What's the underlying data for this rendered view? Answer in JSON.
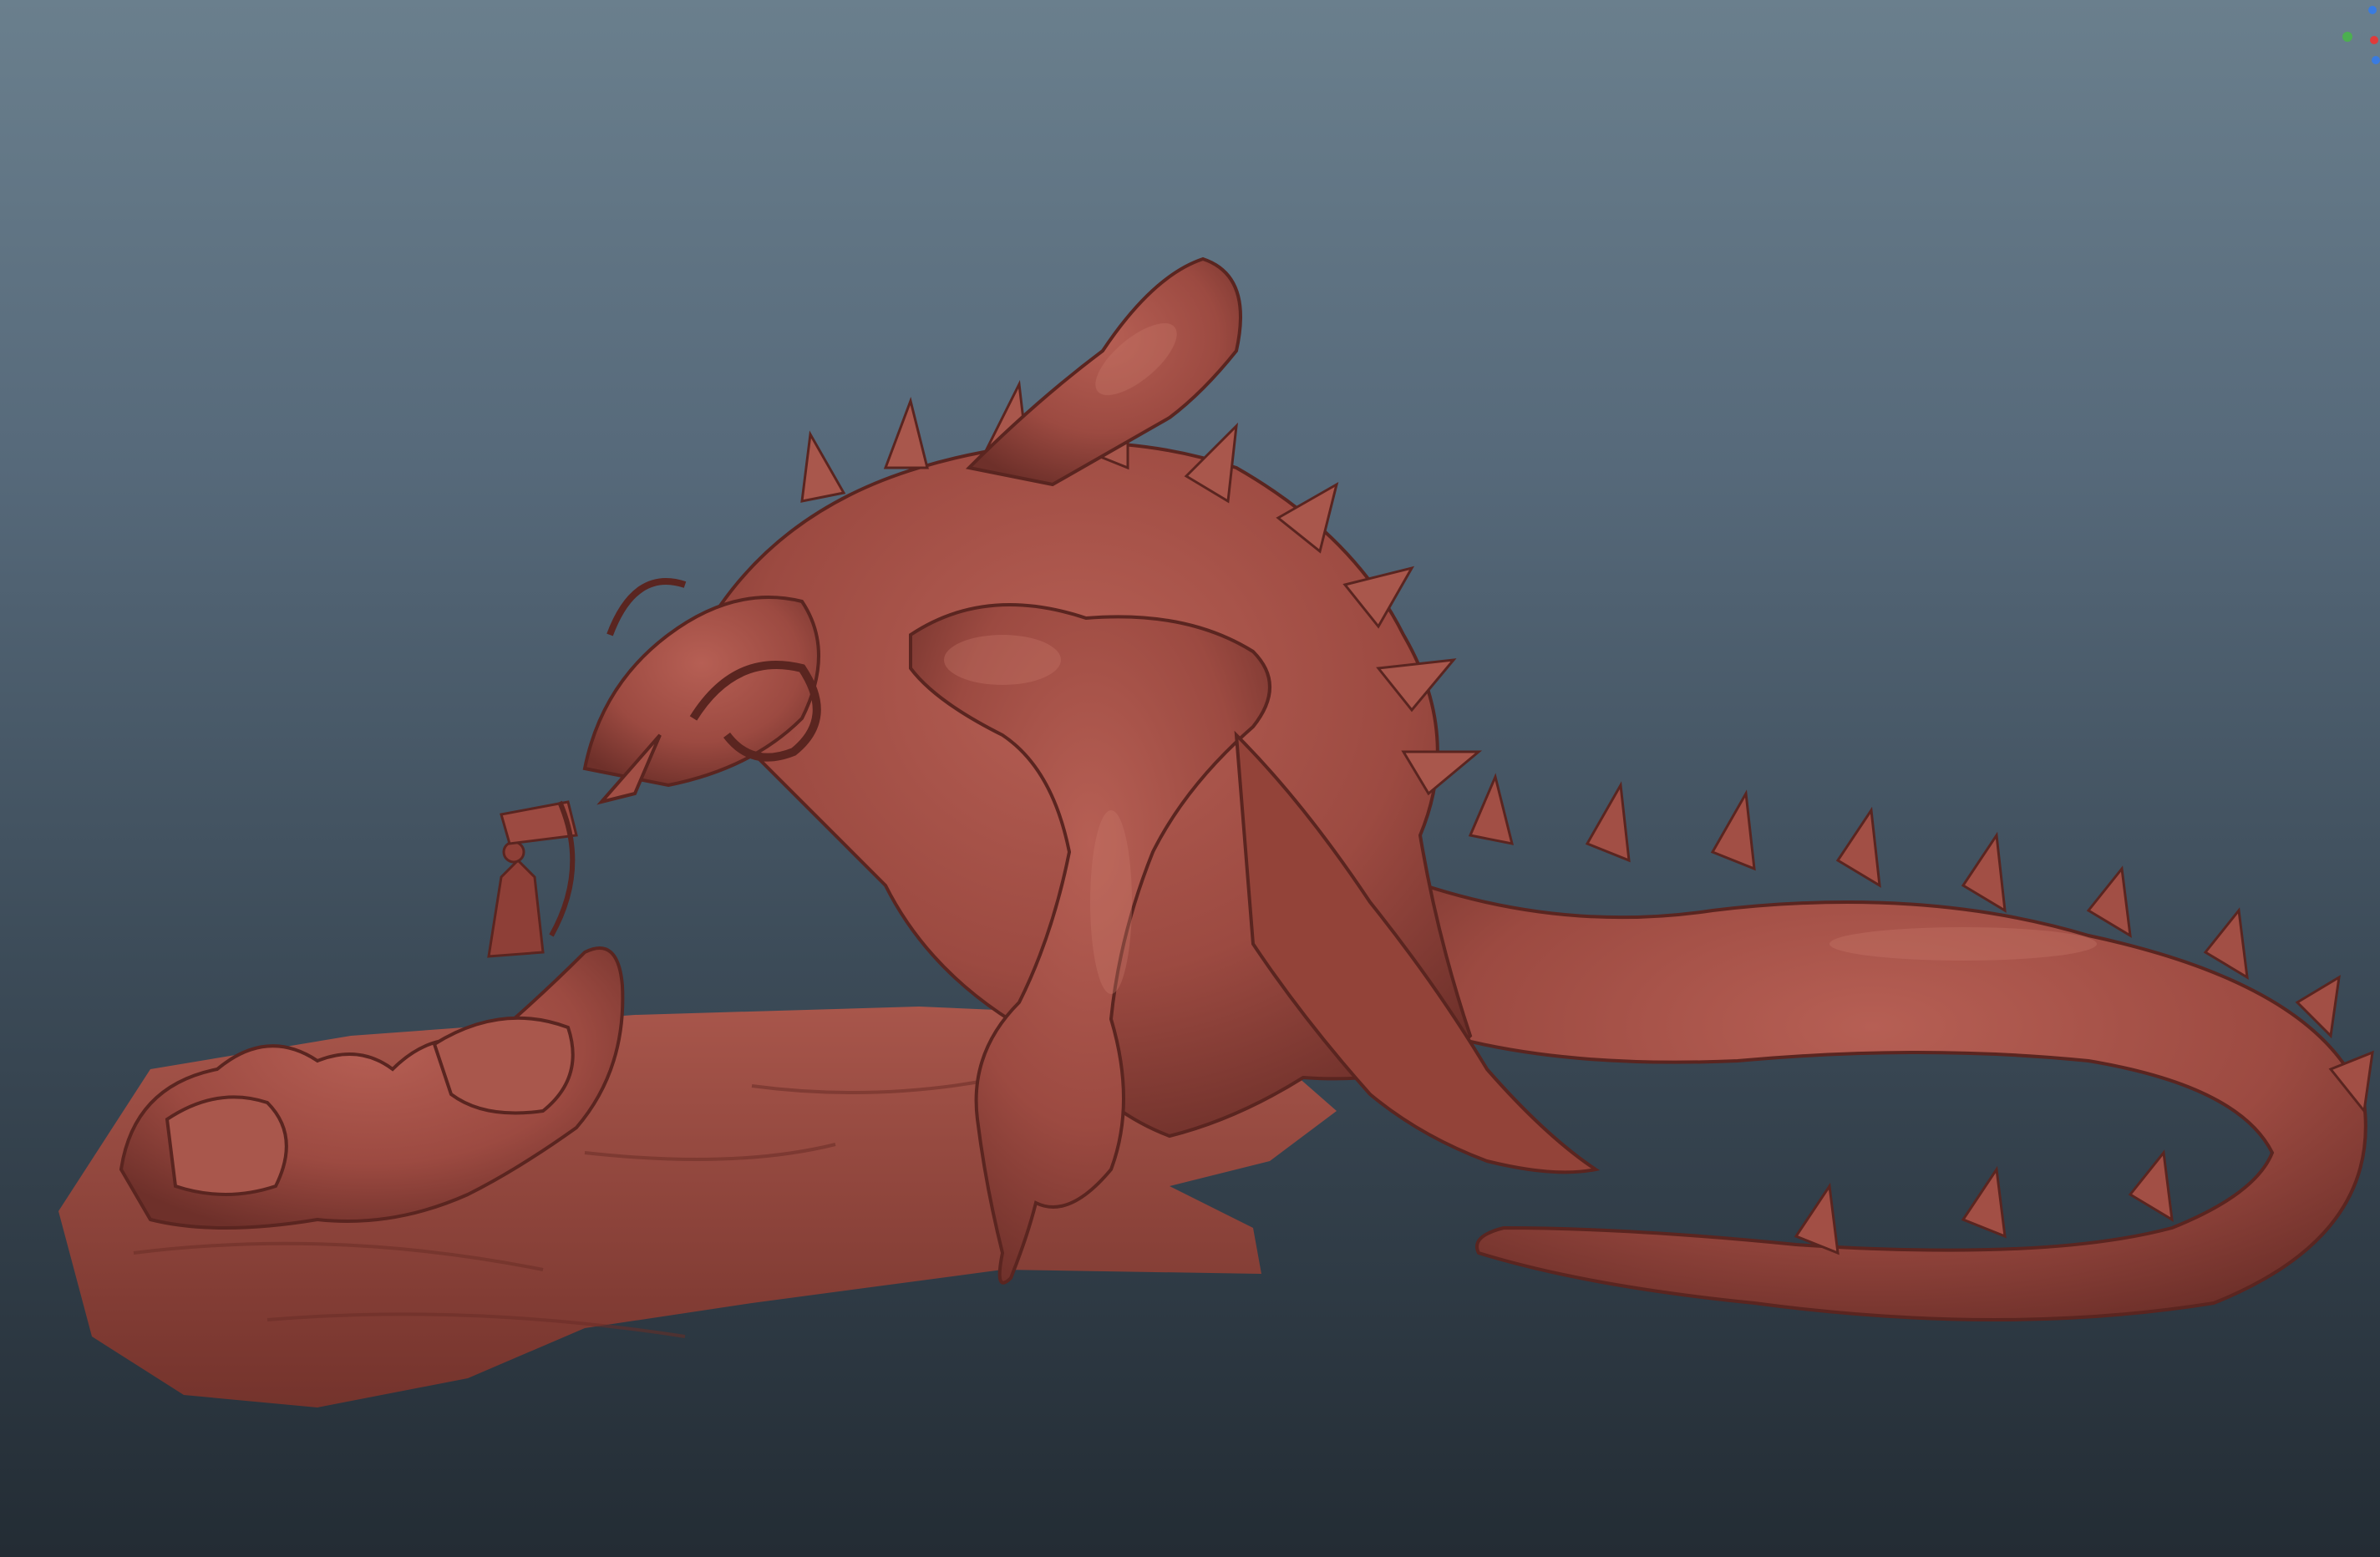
{
  "viewport": {
    "background_top": "#6a7f8d",
    "background_bottom": "#232c34"
  },
  "model": {
    "material_color": "#9c4a41",
    "shadow_color": "#5a2520",
    "highlight_color": "#c8786c",
    "subjects": [
      "dragon",
      "archer-figure",
      "rock-base"
    ]
  },
  "axis_gizmo": {
    "x_color": "#e03a3a",
    "y_color": "#4caf50",
    "z_color": "#3a7be0",
    "icon": "axis-gizmo-icon"
  }
}
